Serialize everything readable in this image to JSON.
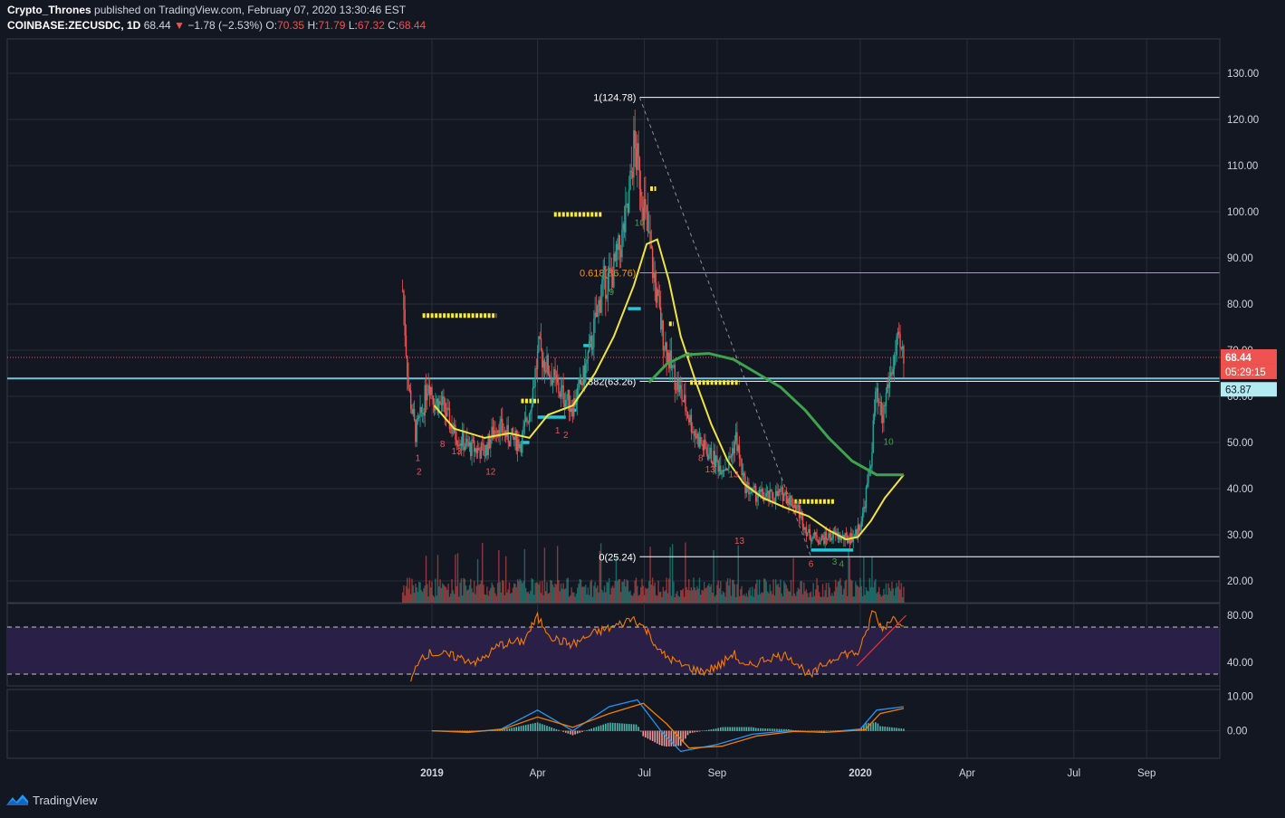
{
  "header": {
    "author": "Crypto_Thrones",
    "published_text": "published on TradingView.com, February 07, 2020 13:30:46 EST",
    "symbol": "COINBASE:ZECUSDC, 1D",
    "last": "68.44",
    "change": "−1.78 (−2.53%)",
    "o_label": "O:",
    "o_val": "70.35",
    "h_label": "H:",
    "h_val": "71.79",
    "l_label": "L:",
    "l_val": "67.32",
    "c_label": "C:",
    "c_val": "68.44"
  },
  "brand": {
    "name": "TradingView",
    "icon": "tradingview-logo-icon"
  },
  "colors": {
    "background": "#131722",
    "grid": "#2a2e39",
    "up": "#26a69a",
    "down": "#ef5350",
    "sma_fast": "#f0e442",
    "sma_slow": "#3fa34d",
    "support": "#6ec6e0",
    "fib_618": "#f7931a",
    "rsi": "#f57c00",
    "rsi_band": "#2a1f46",
    "macd": "#2196f3",
    "signal": "#f57c00"
  },
  "chart_data": {
    "type": "candlestick",
    "symbol": "COINBASE:ZECUSDC",
    "interval": "1D",
    "price_axis": {
      "ylim": [
        15,
        135
      ],
      "ticks": [
        20,
        30,
        40,
        50,
        60,
        70,
        80,
        90,
        100,
        110,
        120,
        130
      ],
      "tick_labels": [
        "20.00",
        "30.00",
        "40.00",
        "50.00",
        "60.00",
        "70.00",
        "80.00",
        "90.00",
        "100.00",
        "110.00",
        "120.00",
        "130.00"
      ]
    },
    "time_axis": {
      "labels": [
        "2019",
        "Apr",
        "Jul",
        "Sep",
        "2020",
        "Apr",
        "Jul",
        "Sep"
      ],
      "bold": [
        "2019",
        "2020"
      ]
    },
    "price_series": [
      [
        "2018-12-07",
        83
      ],
      [
        "2018-12-12",
        62
      ],
      [
        "2018-12-18",
        52
      ],
      [
        "2018-12-24",
        57
      ],
      [
        "2018-12-29",
        64
      ],
      [
        "2019-01-03",
        59
      ],
      [
        "2019-01-10",
        58
      ],
      [
        "2019-01-20",
        52
      ],
      [
        "2019-02-01",
        49
      ],
      [
        "2019-02-15",
        48
      ],
      [
        "2019-02-25",
        54
      ],
      [
        "2019-03-08",
        51
      ],
      [
        "2019-03-18",
        50
      ],
      [
        "2019-03-25",
        57
      ],
      [
        "2019-04-02",
        70
      ],
      [
        "2019-04-10",
        66
      ],
      [
        "2019-04-20",
        61
      ],
      [
        "2019-05-01",
        58
      ],
      [
        "2019-05-10",
        64
      ],
      [
        "2019-05-18",
        73
      ],
      [
        "2019-05-26",
        84
      ],
      [
        "2019-06-03",
        86
      ],
      [
        "2019-06-10",
        92
      ],
      [
        "2019-06-17",
        100
      ],
      [
        "2019-06-22",
        114
      ],
      [
        "2019-06-27",
        108
      ],
      [
        "2019-07-02",
        99
      ],
      [
        "2019-07-09",
        86
      ],
      [
        "2019-07-16",
        74
      ],
      [
        "2019-07-23",
        67
      ],
      [
        "2019-07-30",
        62
      ],
      [
        "2019-08-06",
        57
      ],
      [
        "2019-08-13",
        52
      ],
      [
        "2019-08-20",
        49
      ],
      [
        "2019-08-27",
        47
      ],
      [
        "2019-09-03",
        45
      ],
      [
        "2019-09-10",
        45
      ],
      [
        "2019-09-17",
        51
      ],
      [
        "2019-09-24",
        41
      ],
      [
        "2019-10-01",
        39
      ],
      [
        "2019-10-15",
        38
      ],
      [
        "2019-10-28",
        39
      ],
      [
        "2019-11-08",
        36
      ],
      [
        "2019-11-18",
        30
      ],
      [
        "2019-11-28",
        29
      ],
      [
        "2019-12-10",
        30
      ],
      [
        "2019-12-20",
        29
      ],
      [
        "2019-12-28",
        30
      ],
      [
        "2020-01-03",
        34
      ],
      [
        "2020-01-10",
        46
      ],
      [
        "2020-01-14",
        60
      ],
      [
        "2020-01-20",
        55
      ],
      [
        "2020-01-24",
        62
      ],
      [
        "2020-01-28",
        66
      ],
      [
        "2020-02-02",
        71
      ],
      [
        "2020-02-07",
        68.44
      ]
    ],
    "fast_ma": [
      [
        "2019-01-03",
        58
      ],
      [
        "2019-01-20",
        53
      ],
      [
        "2019-02-15",
        51
      ],
      [
        "2019-03-08",
        52
      ],
      [
        "2019-03-25",
        51
      ],
      [
        "2019-04-10",
        56
      ],
      [
        "2019-05-01",
        58
      ],
      [
        "2019-05-20",
        65
      ],
      [
        "2019-06-05",
        73
      ],
      [
        "2019-06-22",
        84
      ],
      [
        "2019-07-03",
        93
      ],
      [
        "2019-07-12",
        94
      ],
      [
        "2019-07-22",
        85
      ],
      [
        "2019-08-01",
        73
      ],
      [
        "2019-08-14",
        63
      ],
      [
        "2019-08-27",
        54
      ],
      [
        "2019-09-10",
        46
      ],
      [
        "2019-09-24",
        41
      ],
      [
        "2019-10-10",
        38
      ],
      [
        "2019-10-28",
        36
      ],
      [
        "2019-11-18",
        34
      ],
      [
        "2019-12-05",
        31
      ],
      [
        "2019-12-20",
        29
      ],
      [
        "2019-12-30",
        29.5
      ],
      [
        "2020-01-10",
        33
      ],
      [
        "2020-01-22",
        38
      ],
      [
        "2020-02-07",
        43
      ]
    ],
    "slow_ma": [
      [
        "2019-07-05",
        63
      ],
      [
        "2019-07-20",
        67
      ],
      [
        "2019-08-05",
        69
      ],
      [
        "2019-08-25",
        69.3
      ],
      [
        "2019-09-15",
        68
      ],
      [
        "2019-10-05",
        65
      ],
      [
        "2019-10-25",
        62
      ],
      [
        "2019-11-15",
        57
      ],
      [
        "2019-12-05",
        51
      ],
      [
        "2019-12-25",
        46
      ],
      [
        "2020-01-15",
        43
      ],
      [
        "2020-02-07",
        43
      ]
    ],
    "fib_levels": [
      {
        "label": "1(124.78)",
        "value": 124.78
      },
      {
        "label": "0.618(86.76)",
        "value": 86.76
      },
      {
        "label": "0.382(63.26)",
        "value": 63.26
      },
      {
        "label": "0(25.24)",
        "value": 25.24
      }
    ],
    "current_price": {
      "value": 68.44,
      "label": "68.44",
      "countdown": "05:29:15"
    },
    "horizontal_line": {
      "value": 63.87,
      "label": "63.87"
    },
    "yellow_levels": [
      [
        "2018-12-24",
        "2019-02-25",
        77.5
      ],
      [
        "2019-03-18",
        "2019-04-02",
        59
      ],
      [
        "2019-04-15",
        "2019-05-26",
        99.4
      ],
      [
        "2019-07-06",
        "2019-07-11",
        105
      ],
      [
        "2019-07-22",
        "2019-07-26",
        75.7
      ],
      [
        "2019-08-06",
        "2019-08-10",
        69
      ],
      [
        "2019-08-09",
        "2019-09-20",
        63
      ],
      [
        "2019-11-06",
        "2019-12-10",
        37.2
      ]
    ],
    "cyan_levels": [
      [
        "2019-03-18",
        "2019-03-25",
        50
      ],
      [
        "2019-04-01",
        "2019-04-25",
        55.5
      ],
      [
        "2019-04-28",
        "2019-05-04",
        57
      ],
      [
        "2019-05-10",
        "2019-05-17",
        71
      ],
      [
        "2019-06-17",
        "2019-06-28",
        79
      ],
      [
        "2019-11-20",
        "2019-12-26",
        26.7
      ]
    ],
    "td_counts_red": [
      {
        "d": "2018-12-20",
        "v": 46,
        "t": "1"
      },
      {
        "d": "2018-12-21",
        "v": 43,
        "t": "2"
      },
      {
        "d": "2019-01-10",
        "v": 49,
        "t": "8"
      },
      {
        "d": "2019-01-22",
        "v": 47.5,
        "t": "13"
      },
      {
        "d": "2019-02-20",
        "v": 43,
        "t": "12"
      },
      {
        "d": "2019-04-18",
        "v": 52,
        "t": "1"
      },
      {
        "d": "2019-04-25",
        "v": 51,
        "t": "2"
      },
      {
        "d": "2019-08-18",
        "v": 46,
        "t": "8"
      },
      {
        "d": "2019-08-26",
        "v": 43.5,
        "t": "13"
      },
      {
        "d": "2019-09-15",
        "v": 42.5,
        "t": "13"
      },
      {
        "d": "2019-09-20",
        "v": 28,
        "t": "13"
      },
      {
        "d": "2019-11-20",
        "v": 23,
        "t": "6"
      }
    ],
    "td_counts_green": [
      {
        "d": "2019-06-03",
        "v": 82,
        "t": "9"
      },
      {
        "d": "2019-06-27",
        "v": 97,
        "t": "10"
      },
      {
        "d": "2019-12-10",
        "v": 23.5,
        "t": "3"
      },
      {
        "d": "2019-12-16",
        "v": 23,
        "t": "4"
      },
      {
        "d": "2020-01-25",
        "v": 49.5,
        "t": "10"
      }
    ],
    "rsi": {
      "ticks": [
        40,
        80
      ],
      "tick_labels": [
        "40.00",
        "80.00"
      ],
      "overbought": 70,
      "oversold": 30,
      "ylim": [
        20,
        90
      ],
      "values": [
        [
          "2018-12-14",
          22
        ],
        [
          "2018-12-22",
          45
        ],
        [
          "2019-01-01",
          48
        ],
        [
          "2019-01-20",
          45
        ],
        [
          "2019-02-10",
          40
        ],
        [
          "2019-02-28",
          55
        ],
        [
          "2019-03-20",
          58
        ],
        [
          "2019-04-01",
          78
        ],
        [
          "2019-04-15",
          60
        ],
        [
          "2019-05-01",
          55
        ],
        [
          "2019-05-20",
          65
        ],
        [
          "2019-06-10",
          72
        ],
        [
          "2019-06-22",
          78
        ],
        [
          "2019-07-05",
          65
        ],
        [
          "2019-07-15",
          48
        ],
        [
          "2019-08-01",
          38
        ],
        [
          "2019-08-20",
          32
        ],
        [
          "2019-09-05",
          38
        ],
        [
          "2019-09-15",
          48
        ],
        [
          "2019-09-25",
          35
        ],
        [
          "2019-10-15",
          44
        ],
        [
          "2019-11-01",
          46
        ],
        [
          "2019-11-20",
          28
        ],
        [
          "2019-12-01",
          38
        ],
        [
          "2019-12-15",
          47
        ],
        [
          "2019-12-30",
          48
        ],
        [
          "2020-01-05",
          60
        ],
        [
          "2020-01-12",
          85
        ],
        [
          "2020-01-20",
          68
        ],
        [
          "2020-01-28",
          78
        ],
        [
          "2020-02-07",
          74
        ]
      ]
    },
    "macd": {
      "ticks": [
        0,
        10
      ],
      "tick_labels": [
        "0.00",
        "10.00"
      ],
      "ylim": [
        -8,
        12
      ],
      "macd_line": [
        [
          "2019-01-01",
          0
        ],
        [
          "2019-02-01",
          -0.5
        ],
        [
          "2019-03-01",
          0.5
        ],
        [
          "2019-04-01",
          6
        ],
        [
          "2019-05-01",
          0
        ],
        [
          "2019-06-01",
          7
        ],
        [
          "2019-06-25",
          9
        ],
        [
          "2019-07-15",
          0
        ],
        [
          "2019-08-01",
          -6
        ],
        [
          "2019-09-01",
          -4
        ],
        [
          "2019-10-01",
          -1
        ],
        [
          "2019-11-01",
          0
        ],
        [
          "2019-12-01",
          -0.5
        ],
        [
          "2020-01-01",
          0.5
        ],
        [
          "2020-01-15",
          6
        ],
        [
          "2020-02-07",
          7
        ]
      ],
      "signal_line": [
        [
          "2019-01-01",
          0
        ],
        [
          "2019-02-01",
          -0.3
        ],
        [
          "2019-03-01",
          0.3
        ],
        [
          "2019-04-01",
          4
        ],
        [
          "2019-05-01",
          1
        ],
        [
          "2019-06-01",
          5
        ],
        [
          "2019-06-30",
          8
        ],
        [
          "2019-07-20",
          2
        ],
        [
          "2019-08-08",
          -5
        ],
        [
          "2019-09-05",
          -4.5
        ],
        [
          "2019-10-05",
          -1.5
        ],
        [
          "2019-11-05",
          -0.2
        ],
        [
          "2019-12-05",
          -0.4
        ],
        [
          "2020-01-05",
          0.3
        ],
        [
          "2020-01-18",
          5
        ],
        [
          "2020-02-07",
          6.5
        ]
      ]
    }
  }
}
